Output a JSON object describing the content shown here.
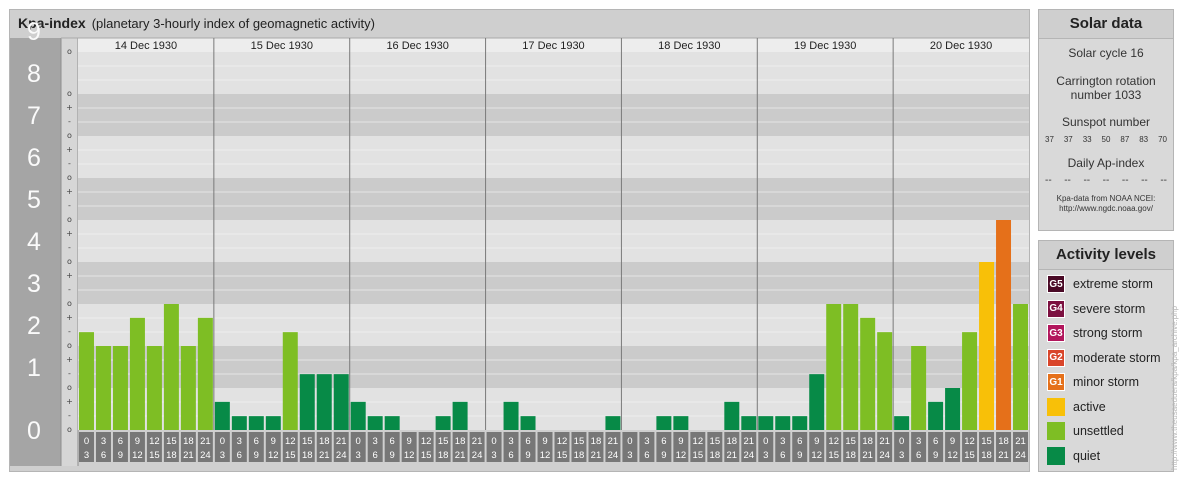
{
  "header": {
    "title": "Kpa-index",
    "subtitle": "(planetary 3-hourly index of geomagnetic activity)"
  },
  "solar": {
    "title": "Solar data",
    "cycle": "Solar cycle 16",
    "carrington_line1": "Carrington rotation",
    "carrington_line2": "number 1033",
    "sunspot_title": "Sunspot number",
    "sunspots": [
      "37",
      "37",
      "33",
      "50",
      "87",
      "83",
      "70"
    ],
    "ap_title": "Daily Ap-index",
    "ap": [
      "--",
      "--",
      "--",
      "--",
      "--",
      "--",
      "--"
    ],
    "note_line1": "Kpa-data from NOAA NCEI:",
    "note_line2": "http://www.ngdc.noaa.gov/"
  },
  "levels": {
    "title": "Activity levels",
    "items": [
      {
        "badge": "G5",
        "label": "extreme storm",
        "color": "#4a0a26"
      },
      {
        "badge": "G4",
        "label": "severe storm",
        "color": "#7c1040"
      },
      {
        "badge": "G3",
        "label": "strong storm",
        "color": "#b2165c"
      },
      {
        "badge": "G2",
        "label": "moderate storm",
        "color": "#d9452a"
      },
      {
        "badge": "G1",
        "label": "minor storm",
        "color": "#e5701a"
      },
      {
        "badge": "",
        "label": "active",
        "color": "#f8c008"
      },
      {
        "badge": "",
        "label": "unsettled",
        "color": "#7ebe24"
      },
      {
        "badge": "",
        "label": "quiet",
        "color": "#078a47"
      }
    ]
  },
  "credit": "http://www.theusaeduera/kpa/kpa_archive.php",
  "chart_data": {
    "type": "bar",
    "title": "Kpa-index",
    "ylim": [
      0,
      9
    ],
    "y_ticks": [
      "0",
      "1",
      "2",
      "3",
      "4",
      "5",
      "6",
      "7",
      "8",
      "9"
    ],
    "minor_marks": [
      "o",
      "+",
      "-"
    ],
    "days": [
      "14 Dec 1930",
      "15 Dec 1930",
      "16 Dec 1930",
      "17 Dec 1930",
      "18 Dec 1930",
      "19 Dec 1930",
      "20 Dec 1930"
    ],
    "interval_starts": [
      "0",
      "3",
      "6",
      "9",
      "12",
      "15",
      "18",
      "21"
    ],
    "interval_ends": [
      "3",
      "6",
      "9",
      "12",
      "15",
      "18",
      "21",
      "24"
    ],
    "values": [
      [
        2.33,
        2.0,
        2.0,
        2.67,
        2.0,
        3.0,
        2.0,
        2.67
      ],
      [
        0.67,
        0.33,
        0.33,
        0.33,
        2.33,
        1.33,
        1.33,
        1.33
      ],
      [
        0.67,
        0.33,
        0.33,
        0.0,
        0.0,
        0.33,
        0.67,
        0.0
      ],
      [
        0.0,
        0.67,
        0.33,
        0.0,
        0.0,
        0.0,
        0.0,
        0.33
      ],
      [
        0.0,
        0.0,
        0.33,
        0.33,
        0.0,
        0.0,
        0.67,
        0.33
      ],
      [
        0.33,
        0.33,
        0.33,
        1.33,
        3.0,
        3.0,
        2.67,
        2.33
      ],
      [
        0.33,
        2.0,
        0.67,
        1.0,
        2.33,
        4.0,
        5.0,
        3.0
      ]
    ],
    "colors": {
      "quiet": "#078a47",
      "unsettled": "#7ebe24",
      "active": "#f8c008",
      "minor": "#e5701a",
      "moderate": "#d9452a"
    }
  }
}
